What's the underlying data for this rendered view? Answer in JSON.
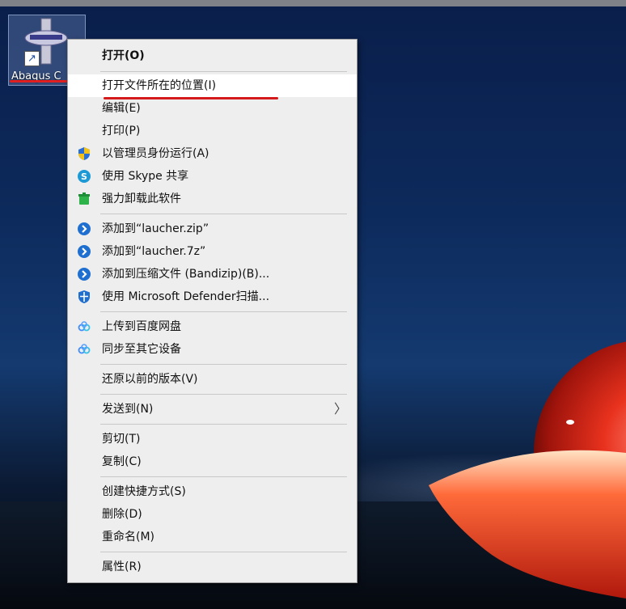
{
  "desktop": {
    "icon_label": "Abaqus C"
  },
  "menu": {
    "items": [
      {
        "label": "打开(O)",
        "icon": ""
      },
      {
        "label": "打开文件所在的位置(I)",
        "icon": ""
      },
      {
        "label": "编辑(E)",
        "icon": ""
      },
      {
        "label": "打印(P)",
        "icon": ""
      },
      {
        "label": "以管理员身份运行(A)",
        "icon": "uac-shield-icon"
      },
      {
        "label": "使用 Skype 共享",
        "icon": "skype-icon"
      },
      {
        "label": "强力卸载此软件",
        "icon": "uninstall-icon"
      },
      {
        "label": "添加到“laucher.zip”",
        "icon": "bandizip-icon"
      },
      {
        "label": "添加到“laucher.7z”",
        "icon": "bandizip-icon"
      },
      {
        "label": "添加到压缩文件 (Bandizip)(B)...",
        "icon": "bandizip-icon"
      },
      {
        "label": "使用 Microsoft Defender扫描...",
        "icon": "defender-icon"
      },
      {
        "label": "上传到百度网盘",
        "icon": "baidu-netdisk-icon"
      },
      {
        "label": "同步至其它设备",
        "icon": "baidu-netdisk-icon"
      },
      {
        "label": "还原以前的版本(V)",
        "icon": ""
      },
      {
        "label": "发送到(N)",
        "icon": "",
        "submenu_arrow": "〉"
      },
      {
        "label": "剪切(T)",
        "icon": ""
      },
      {
        "label": "复制(C)",
        "icon": ""
      },
      {
        "label": "创建快捷方式(S)",
        "icon": ""
      },
      {
        "label": "删除(D)",
        "icon": ""
      },
      {
        "label": "重命名(M)",
        "icon": ""
      },
      {
        "label": "属性(R)",
        "icon": ""
      }
    ]
  },
  "colors": {
    "menu_bg": "#eeeeee",
    "highlight_underline": "#d41a1a",
    "bandizip_blue": "#1f6fd1",
    "skype_blue": "#1d9ad6",
    "uninstall_green": "#2db34a"
  }
}
